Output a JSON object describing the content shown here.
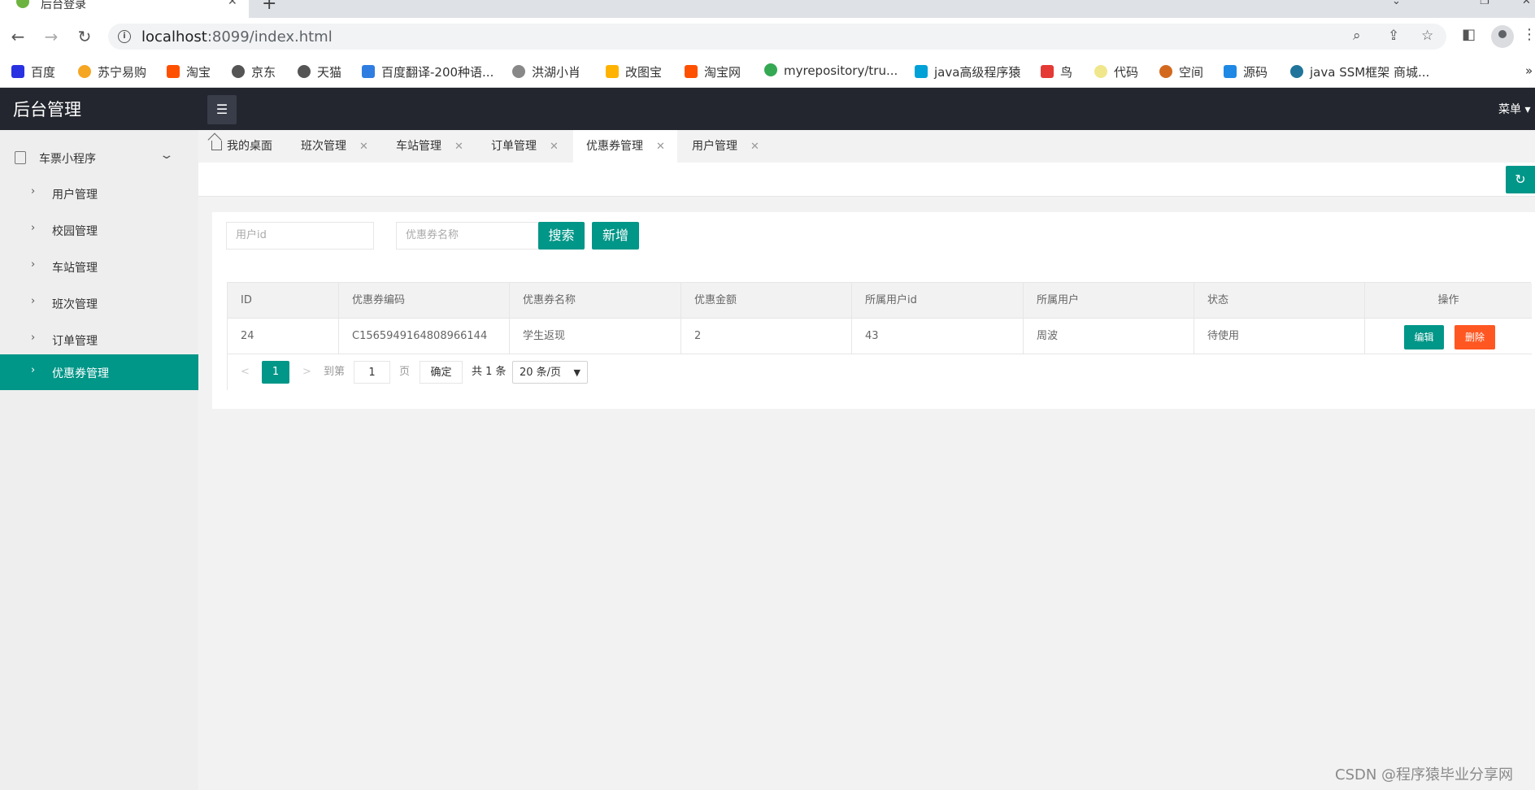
{
  "browser": {
    "tab_title": "后台登录",
    "url_host": "localhost",
    "url_rest": ":8099/index.html",
    "bookmarks": [
      "百度",
      "苏宁易购",
      "淘宝",
      "京东",
      "天猫",
      "百度翻译-200种语...",
      "洪湖小肖",
      "改图宝",
      "淘宝网",
      "myrepository/tru...",
      "java高级程序猿",
      "鸟",
      "代码",
      "空间",
      "源码",
      "java SSM框架 商城..."
    ],
    "bookmark_more": "»"
  },
  "app": {
    "title": "后台管理",
    "header_menu": "菜单 ▾"
  },
  "sidebar": {
    "group_label": "车票小程序",
    "items": [
      {
        "label": "用户管理"
      },
      {
        "label": "校园管理"
      },
      {
        "label": "车站管理"
      },
      {
        "label": "班次管理"
      },
      {
        "label": "订单管理"
      },
      {
        "label": "优惠券管理"
      }
    ],
    "active_index": 5
  },
  "content_tabs": {
    "home": "我的桌面",
    "tabs": [
      "班次管理",
      "车站管理",
      "订单管理",
      "优惠券管理",
      "用户管理"
    ],
    "active": "优惠券管理",
    "close_glyph": "✕"
  },
  "search": {
    "user_id_placeholder": "用户id",
    "coupon_name_placeholder": "优惠券名称",
    "search_label": "搜索",
    "add_label": "新增"
  },
  "table": {
    "headers": [
      "ID",
      "优惠券编码",
      "优惠券名称",
      "优惠金额",
      "所属用户id",
      "所属用户",
      "状态",
      "操作"
    ],
    "rows": [
      {
        "id": "24",
        "code": "C1565949164808966144",
        "name": "学生返现",
        "amount": "2",
        "user_id": "43",
        "user": "周波",
        "status": "待使用"
      }
    ],
    "edit_label": "编辑",
    "delete_label": "删除"
  },
  "pagination": {
    "prev": "<",
    "current_page": "1",
    "next": ">",
    "goto_label": "到第",
    "goto_value": "1",
    "page_suffix": "页",
    "confirm_label": "确定",
    "total_label": "共 1 条",
    "page_size": "20 条/页"
  },
  "watermark": "CSDN @程序猿毕业分享网",
  "colors": {
    "accent": "#009688",
    "danger": "#ff5722",
    "header_bg": "#23262e"
  }
}
